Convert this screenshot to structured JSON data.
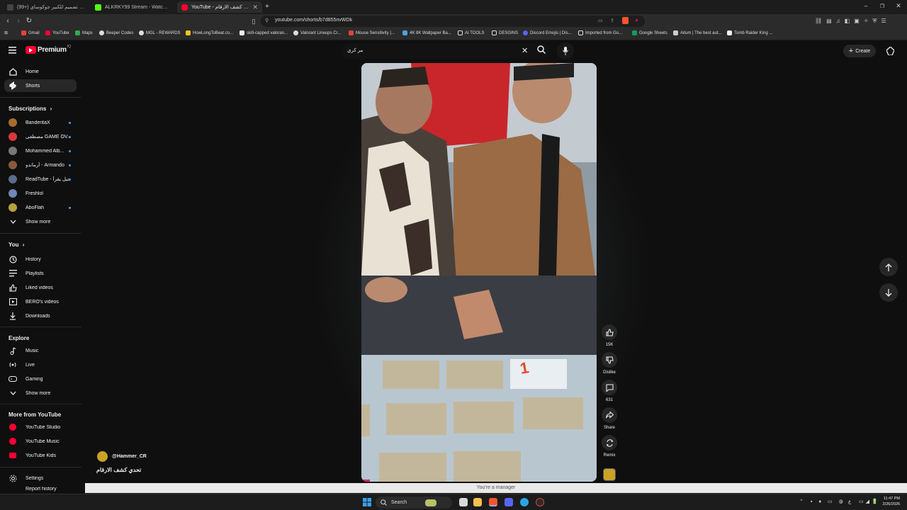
{
  "browser": {
    "tabs": [
      {
        "title": "(99+) تصميم للكبير جوكوساي ❤️ BF"
      },
      {
        "title": "ALKRKY99 Stream - Watch Live on Ki"
      },
      {
        "title": "YouTube - تحدي كشف الارقام"
      }
    ],
    "url": "youtube.com/shorts/b7d855nvWDk",
    "bookmarks": [
      "Gmail",
      "YouTube",
      "Maps",
      "Beeper Codes",
      "MGL - REWARDS",
      "HowLongToBeat.co...",
      "skill-capped valoran...",
      "Valorant Lineups Cr...",
      "Mouse Sensitivity |...",
      "4K 8K Wallpaper Ba...",
      "AI TOOLS",
      "DESGINS",
      "Discord Emojis | Dis...",
      "Imported from Go...",
      "Google Sheets",
      "Aitum | The best aut...",
      "Tomb Raider King ..."
    ]
  },
  "youtube": {
    "logo_text": "Premium",
    "logo_sup": "IQ",
    "search_value": "مر كري",
    "create_label": "Create"
  },
  "sidebar": {
    "main": [
      "Home",
      "Shorts"
    ],
    "subscriptions_title": "Subscriptions",
    "subscriptions": [
      "BanderitaX",
      "مصطفى GAME OV...",
      "Mohammed Alb...",
      "أرماندو - Armando",
      "ReadTube - جيل يقرأ",
      "Freshlol",
      "AboFlah"
    ],
    "show_more": "Show more",
    "you_title": "You",
    "you_items": [
      "History",
      "Playlists",
      "Liked videos",
      "BERO's videos",
      "Downloads"
    ],
    "explore_title": "Explore",
    "explore_items": [
      "Music",
      "Live",
      "Gaming"
    ],
    "explore_more": "Show more",
    "more_title": "More from YouTube",
    "more_items": [
      "YouTube Studio",
      "YouTube Music",
      "YouTube Kids"
    ],
    "settings": "Settings",
    "report": "Report history"
  },
  "short": {
    "channel": "@Hammer_CR",
    "title": "تحدي كشف الارقام",
    "likes": "15K",
    "dislike_label": "Dislike",
    "comments": "631",
    "share_label": "Share",
    "remix_label": "Remix",
    "card_number": "1"
  },
  "status_message": "You're a manager",
  "taskbar": {
    "search_label": "Search",
    "time": "11:47 PM",
    "date": "2/26/2026",
    "lang": "ع"
  }
}
